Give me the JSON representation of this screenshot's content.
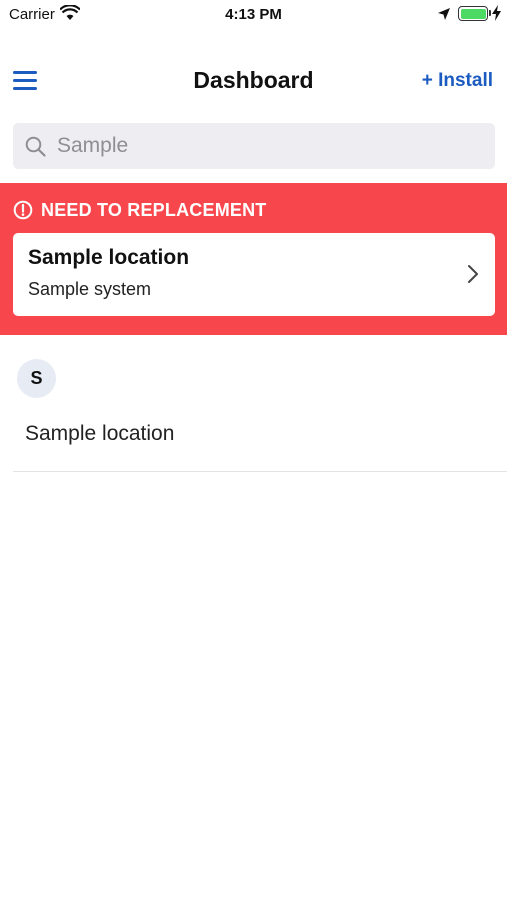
{
  "status_bar": {
    "carrier": "Carrier",
    "time": "4:13 PM",
    "icons": [
      "wifi-icon",
      "location-arrow-icon",
      "battery-icon",
      "charging-bolt-icon"
    ],
    "battery_level": 1.0
  },
  "nav": {
    "title": "Dashboard",
    "install_label": "+ Install",
    "menu_icon": "hamburger-menu-icon"
  },
  "search": {
    "placeholder": "Sample",
    "value": "",
    "icon": "search-icon"
  },
  "alert": {
    "title": "NEED TO REPLACEMENT",
    "icon": "exclamation-circle-icon",
    "card": {
      "title": "Sample location",
      "subtitle": "Sample system",
      "icon": "chevron-right-icon"
    }
  },
  "section": {
    "letter": "S",
    "items": [
      {
        "label": "Sample location"
      }
    ]
  },
  "colors": {
    "accent": "#1c5bbf",
    "alert_bg": "#f8474c",
    "search_bg": "#eeeef2",
    "battery_green": "#4cd964",
    "avatar_bg": "#e7ebf3"
  }
}
